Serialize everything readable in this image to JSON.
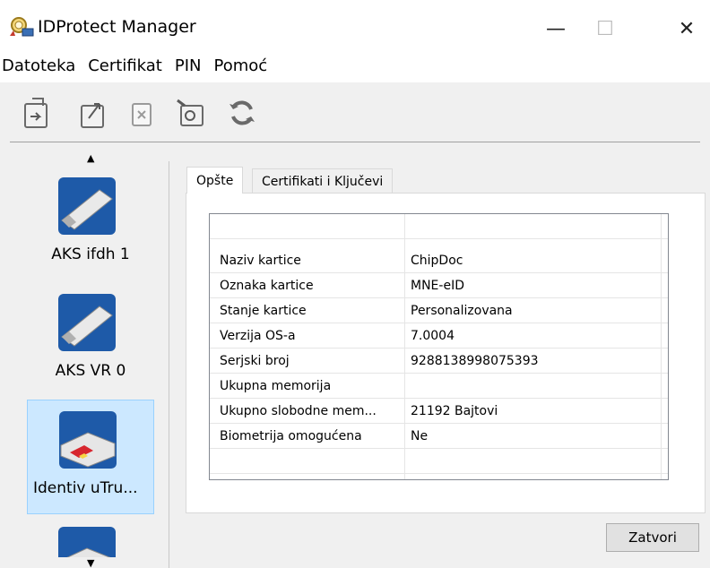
{
  "window": {
    "title": "IDProtect Manager",
    "controls": {
      "minimize": "—",
      "maximize": "☐",
      "close": "✕"
    }
  },
  "menu": [
    {
      "label": "Datoteka"
    },
    {
      "label": "Certifikat"
    },
    {
      "label": "PIN"
    },
    {
      "label": "Pomoć"
    }
  ],
  "toolbar": {
    "icons": [
      "import-icon",
      "export-icon",
      "delete-icon",
      "view-certificate-icon",
      "refresh-icon"
    ]
  },
  "sidebar": {
    "readers": [
      {
        "label": "AKS ifdh 1",
        "icon": "usb-token-icon",
        "selected": false
      },
      {
        "label": "AKS VR 0",
        "icon": "usb-token-icon",
        "selected": false
      },
      {
        "label": "Identiv uTru...",
        "icon": "card-reader-icon",
        "selected": true
      }
    ]
  },
  "tabs": [
    {
      "label": "Opšte",
      "active": true
    },
    {
      "label": "Certifikati i Ključevi",
      "active": false
    }
  ],
  "properties": [
    {
      "name": "Naziv kartice",
      "value": "ChipDoc"
    },
    {
      "name": "Oznaka kartice",
      "value": "MNE-eID"
    },
    {
      "name": "Stanje kartice",
      "value": "Personalizovana"
    },
    {
      "name": "Verzija OS-a",
      "value": "7.0004"
    },
    {
      "name": "Serjski broj",
      "value": "9288138998075393"
    },
    {
      "name": "Ukupna memorija",
      "value": ""
    },
    {
      "name": "Ukupno slobodne mem...",
      "value": "21192 Bajtovi"
    },
    {
      "name": "Biometrija omogućena",
      "value": "Ne"
    }
  ],
  "buttons": {
    "close": "Zatvori"
  },
  "colors": {
    "selection": "#cce8ff",
    "toolbar_bg": "#f0f0f0"
  }
}
